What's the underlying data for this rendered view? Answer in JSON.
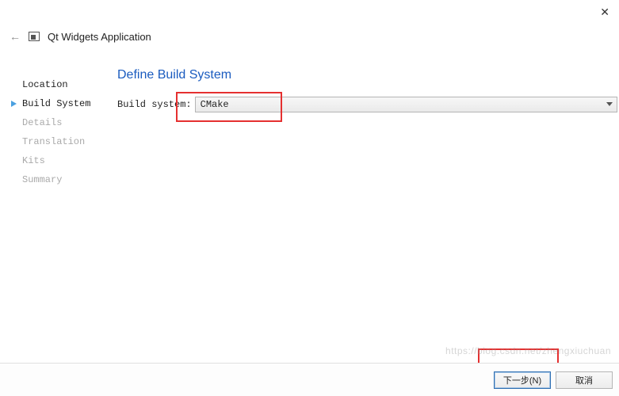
{
  "window": {
    "title": "Qt Widgets Application"
  },
  "sidebar": {
    "items": [
      {
        "label": "Location",
        "state": "done"
      },
      {
        "label": "Build System",
        "state": "active"
      },
      {
        "label": "Details",
        "state": "pending"
      },
      {
        "label": "Translation",
        "state": "pending"
      },
      {
        "label": "Kits",
        "state": "pending"
      },
      {
        "label": "Summary",
        "state": "pending"
      }
    ]
  },
  "main": {
    "heading": "Define Build System",
    "field_label": "Build system:",
    "build_system_value": "CMake"
  },
  "footer": {
    "next_label": "下一步(N)",
    "cancel_label": "取消"
  },
  "watermark": "https://blog.csdn.net/zhengxiuchuan"
}
